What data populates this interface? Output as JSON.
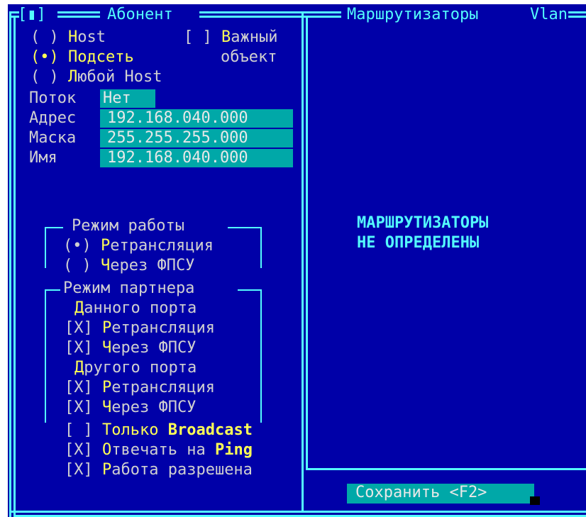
{
  "left_panel": {
    "title": "Абонент",
    "focus_marker": "[▮]",
    "radio_host": {
      "mark": "( )",
      "hot": "H",
      "rest": "ost"
    },
    "radio_subnet": {
      "mark": "(•)",
      "hot": "П",
      "rest": "одсеть"
    },
    "radio_any": {
      "mark": "( )",
      "hot": "Л",
      "rest": "юбой Host"
    },
    "important_check": {
      "mark": "[ ]",
      "hot": "В",
      "rest": "ажный",
      "line2": "объект"
    },
    "stream": {
      "label": "Поток",
      "value": "Нет"
    },
    "address": {
      "label": "Адрес",
      "value": "192.168.040.000"
    },
    "mask": {
      "label": "Маска",
      "value": "255.255.255.000"
    },
    "name": {
      "label": "Имя",
      "value": "192.168.040.000"
    }
  },
  "work_mode": {
    "title": "Режим работы",
    "opt1": {
      "mark": "(•)",
      "hot": "Р",
      "rest": "етрансляция"
    },
    "opt2": {
      "mark": "( )",
      "hot": "Ч",
      "rest": "ерез ФПСУ"
    }
  },
  "partner_mode": {
    "title": "Режим партнера",
    "this_port": {
      "hot": "Д",
      "rest": "анного порта"
    },
    "this_retrans": {
      "mark": "[X]",
      "hot": "Р",
      "rest": "етрансляция"
    },
    "this_fpsu": {
      "mark": "[X]",
      "hot": "Ч",
      "rest": "ерез ФПСУ"
    },
    "other_port": {
      "hot": "Д",
      "rest": "ругого порта"
    },
    "other_retrans": {
      "mark": "[X]",
      "hot": "Р",
      "rest": "етрансляция"
    },
    "other_fpsu": {
      "mark": "[X]",
      "hot": "Ч",
      "rest": "ерез ФПСУ"
    }
  },
  "options": {
    "broadcast": {
      "mark": "[ ]",
      "hot": "Т",
      "rest": "олько ",
      "hot2": "Broadcast"
    },
    "ping": {
      "mark": "[X]",
      "hot": "О",
      "rest": "твечать на ",
      "hot2": "Ping"
    },
    "enabled": {
      "mark": "[X]",
      "hot": "Р",
      "rest": "абота разрешена"
    }
  },
  "right_panel": {
    "title": "Маршрутизаторы",
    "vlan_label": "Vlan",
    "message_line1": "МАРШРУТИЗАТОРЫ",
    "message_line2": "НЕ ОПРЕДЕЛЕНЫ"
  },
  "save_button": {
    "label": "Сохранить <F2>"
  },
  "colors": {
    "background": "#0000a8",
    "frame": "#54fcfc",
    "hotkey": "#ffff55",
    "field": "#00a8a8",
    "text": "#d0d0d0"
  }
}
